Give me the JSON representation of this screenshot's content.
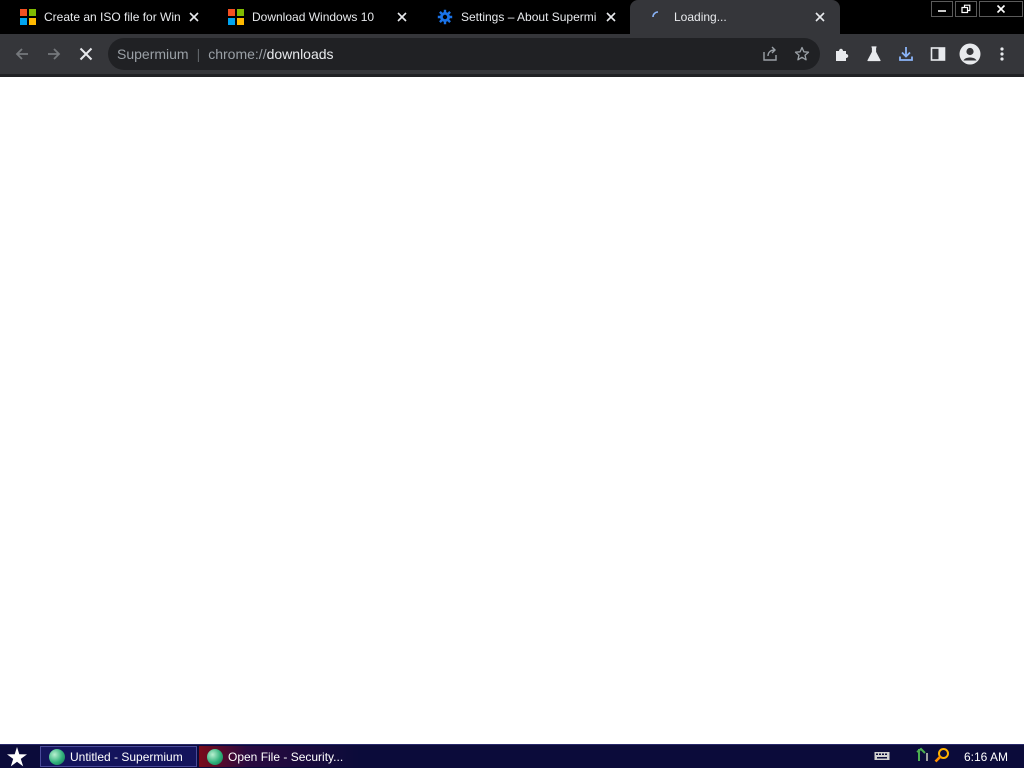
{
  "tabs": [
    {
      "title": "Create an ISO file for Windo",
      "favicon": "microsoft-logo-icon",
      "active": false
    },
    {
      "title": "Download Windows 10",
      "favicon": "microsoft-logo-icon",
      "active": false
    },
    {
      "title": "Settings – About Supermium",
      "favicon": "gear-icon",
      "active": false
    },
    {
      "title": "Loading...",
      "favicon": "loading-spinner-icon",
      "active": true
    }
  ],
  "window_controls": [
    "minimize-icon",
    "restore-icon",
    "close-icon"
  ],
  "toolbar": {
    "buttons_left": [
      "back-arrow-icon",
      "forward-arrow-icon",
      "stop-loading-icon"
    ],
    "buttons_right": [
      "extensions-puzzle-icon",
      "labs-flask-icon",
      "download-icon",
      "side-panel-icon",
      "profile-avatar-icon",
      "more-menu-icon"
    ]
  },
  "omnibox": {
    "site_label": "Supermium",
    "separator": "|",
    "url_scheme": "chrome://",
    "url_host": "downloads",
    "icons": [
      "share-icon",
      "bookmark-star-icon"
    ]
  },
  "taskbar": {
    "start_icon": "start-star-icon",
    "tasks": [
      {
        "label": "Untitled - Supermium",
        "icon": "supermium-globe-icon"
      },
      {
        "label": "Open File - Security...",
        "icon": "supermium-globe-icon"
      }
    ],
    "tray_icons": [
      "keyboard-icon",
      "network-icon",
      "search-icon"
    ],
    "clock": "6:16 AM"
  },
  "colors": {
    "tabstrip_bg": "#000000",
    "active_tab_bg": "#35363a",
    "toolbar_bg": "#35363a",
    "omnibox_bg": "#202124",
    "download_accent": "#8ab4f8",
    "taskbar_bg": "#0b0b3a",
    "settings_gear": "#1a73e8"
  }
}
